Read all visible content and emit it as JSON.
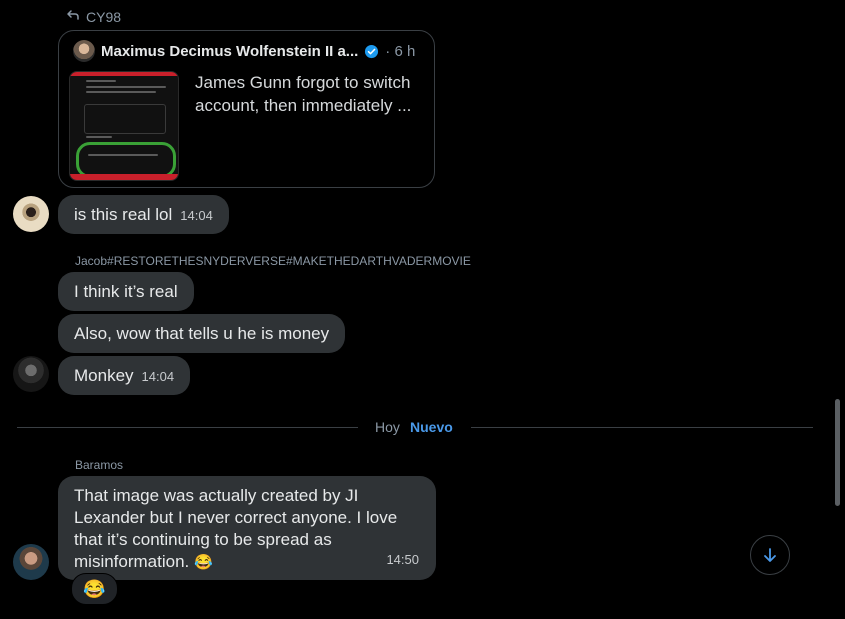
{
  "reply_reference": {
    "name": "CY98"
  },
  "quoted_post": {
    "author": "Maximus Decimus Wolfenstein II a...",
    "age": "6 h",
    "text": "James Gunn forgot to switch account, then immediately ..."
  },
  "messages": [
    {
      "text": "is this real lol",
      "time": "14:04"
    },
    {
      "sender": "Jacob#RESTORETHESNYDERVERSE#MAKETHEDARTHVADERMOVIE",
      "text": "I think it’s real"
    },
    {
      "text": "Also, wow that tells u he is money"
    },
    {
      "text": "Monkey",
      "time": "14:04"
    }
  ],
  "divider": {
    "day": "Hoy",
    "new_label": "Nuevo"
  },
  "last_message": {
    "sender": "Baramos",
    "lines": [
      "That image was actually created by JI",
      "Lexander but I never correct anyone. I love",
      "that it’s continuing to be spread as",
      "misinformation."
    ],
    "emoji": "😂",
    "time": "14:50",
    "reaction": "😂"
  },
  "colors": {
    "background": "#000000",
    "bubble": "#2f3336",
    "accent": "#4a99e9",
    "muted": "#8b98a5"
  },
  "icons": [
    "reply-arrow-icon",
    "verified-badge-icon",
    "arrow-down-icon"
  ]
}
